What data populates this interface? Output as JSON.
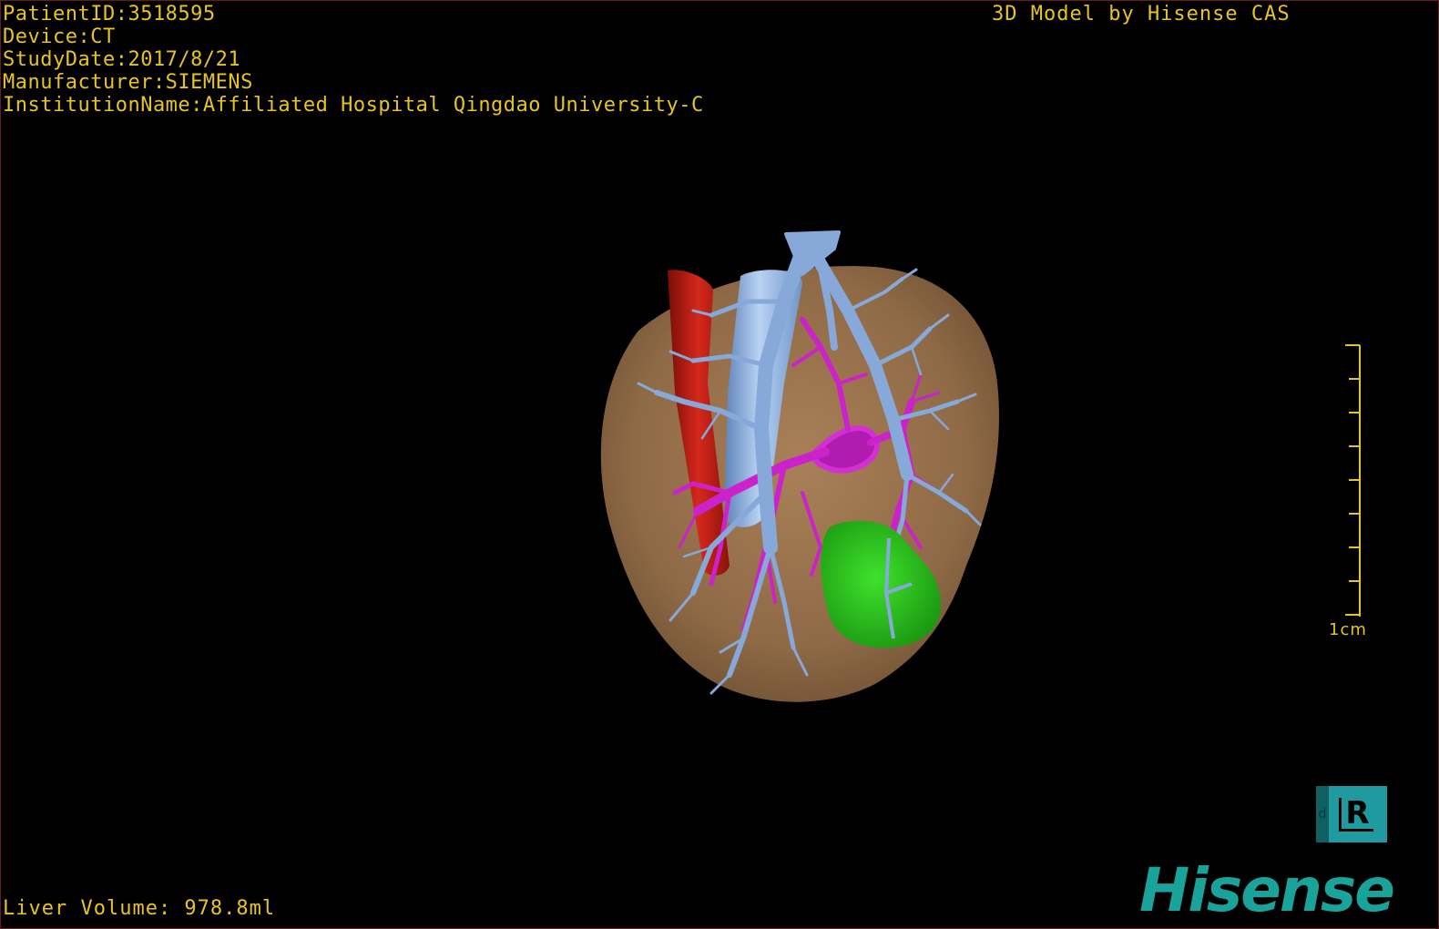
{
  "patient_info": {
    "patient_id": "PatientID:3518595",
    "device": "Device:CT",
    "study_date": "StudyDate:2017/8/21",
    "manufacturer": "Manufacturer:SIEMENS",
    "institution": "InstitutionName:Affiliated Hospital Qingdao University-C"
  },
  "caption": "3D Model by Hisense CAS",
  "liver_volume": "Liver Volume: 978.8ml",
  "scale": {
    "label": "1cm",
    "ticks": 9
  },
  "mode_badge": {
    "tab_text": "d",
    "glyph": "R"
  },
  "logo": {
    "text": "Hisense"
  },
  "colors": {
    "text": "#e8c420",
    "liver": "#9c7450",
    "hepatic_vein": "#7fa6d6",
    "portal_vein": "#cc22cc",
    "artery": "#c81f14",
    "lesion": "#2bc21b",
    "logo": "#1aa39b"
  },
  "model_structures": [
    "liver-surface",
    "hepatic-vein-tree",
    "portal-vein-tree",
    "inferior-vena-cava",
    "aorta",
    "lesion"
  ]
}
